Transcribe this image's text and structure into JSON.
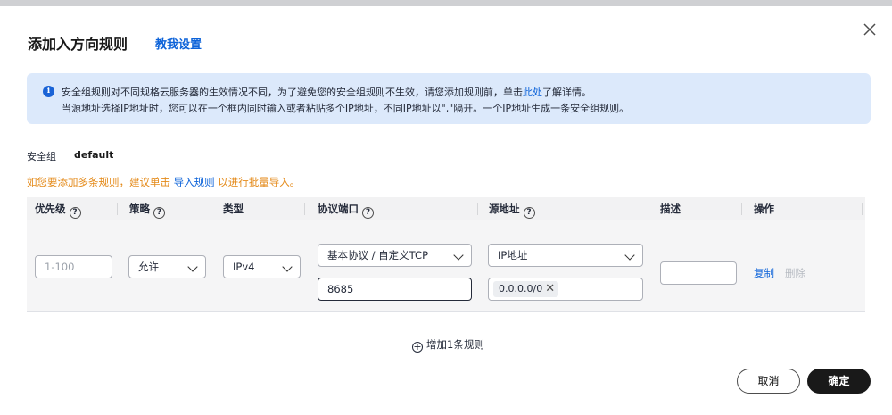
{
  "dialog": {
    "title": "添加入方向规则",
    "help_link": "教我设置",
    "close_icon": "close-icon"
  },
  "notice": {
    "line1_pre": "安全组规则对不同规格云服务器的生效情况不同，为了避免您的安全组规则不生效，请您添加规则前，单击",
    "line1_link": "此处",
    "line1_post": "了解详情。",
    "line2": "当源地址选择IP地址时，您可以在一个框内同时输入或者粘贴多个IP地址，不同IP地址以\",\"隔开。一个IP地址生成一条安全组规则。"
  },
  "security_group": {
    "label": "安全组",
    "value": "default"
  },
  "hint": {
    "pre": "如您要添加多条规则，建议单击 ",
    "link": "导入规则",
    "post": " 以进行批量导入。"
  },
  "table": {
    "columns": [
      "优先级",
      "策略",
      "类型",
      "协议端口",
      "源地址",
      "描述",
      "操作"
    ],
    "help_mark": "?",
    "row": {
      "priority_placeholder": "1-100",
      "policy": "允许",
      "type": "IPv4",
      "protocol": "基本协议 / 自定义TCP",
      "port": "8685",
      "source_type": "IP地址",
      "source_tag": "0.0.0.0/0",
      "tag_remove": "✕",
      "description": "",
      "copy": "复制",
      "delete": "删除"
    }
  },
  "add_rule": {
    "icon": "plus-circle-icon",
    "label": "增加1条规则"
  },
  "footer": {
    "cancel": "取消",
    "ok": "确定"
  },
  "colors": {
    "accent": "#0d63d9",
    "warning": "#e48a19",
    "notice_bg": "#dce9fb",
    "primary_button": "#191919"
  }
}
